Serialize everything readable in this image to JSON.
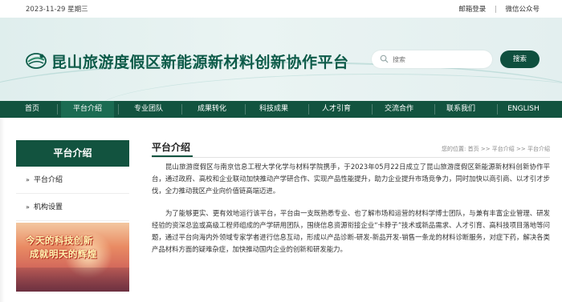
{
  "topbar": {
    "date": "2023-11-29 星期三",
    "links": [
      "邮箱登录",
      "微信公众号"
    ]
  },
  "header": {
    "site_title": "昆山旅游度假区新能源新材料创新协作平台",
    "logo_icon": "leaf-wave-logo-icon",
    "search_placeholder": "搜索",
    "search_button": "搜索"
  },
  "nav": {
    "items": [
      {
        "label": "首页"
      },
      {
        "label": "平台介绍",
        "active": true
      },
      {
        "label": "专业团队"
      },
      {
        "label": "成果转化"
      },
      {
        "label": "科技成果"
      },
      {
        "label": "人才引育"
      },
      {
        "label": "交流合作"
      },
      {
        "label": "联系我们"
      },
      {
        "label": "ENGLISH"
      }
    ]
  },
  "sidebar": {
    "title": "平台介绍",
    "items": [
      {
        "label": "平台介绍",
        "bullet": "»"
      },
      {
        "label": "机构设置",
        "bullet": "»"
      }
    ],
    "banner": {
      "line1": "今天的科技创新",
      "line2": "成就明天的辉煌"
    }
  },
  "main": {
    "title": "平台介绍",
    "breadcrumb": [
      "您的位置:",
      "首页",
      ">>",
      "平台介绍",
      ">>",
      "平台介绍"
    ],
    "paragraphs": [
      "昆山旅游度假区与南京信息工程大学化学与材料学院携手，于2023年05月22日成立了昆山旅游度假区新能源新材料创新协作平台，通过政府、高校和企业联动加快推动产学研合作、实现产品性能提升，助力企业提升市场竞争力，同时加快以商引商、以才引才步伐，全力推动我区产业向价值链高端迈进。",
      "为了能够更实、更有效地运行该平台，平台由一支既熟悉专业、也了解市场和运营的材料学博士团队，与兼有丰富企业管理、研发经验的资深总监或高级工程师组成的产学研用团队，围绕信息资源衔接企业“卡脖子”技术或新品需求、人才引育、高科技项目落地等问题，通过平台向海内外领域专家学者进行信息互动，形成以产品诊断-研发-新品开发-销售一条龙的材料诊断服务，对症下药，解决各类产品材料方面的疑难杂症，加快推动国内企业的创新和研发能力。"
    ]
  },
  "colors": {
    "brand_dark_green": "#12533f",
    "active_nav": "#1b6b52",
    "title_green": "#0d5b49",
    "header_bg": "#e3efef"
  }
}
